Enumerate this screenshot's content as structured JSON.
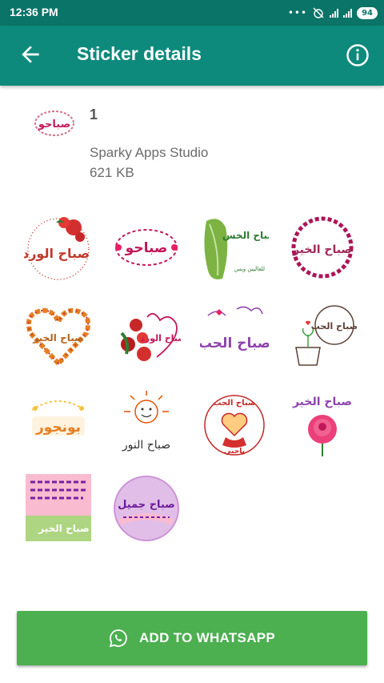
{
  "status_bar": {
    "time": "12:36 PM",
    "battery": "94"
  },
  "app_bar": {
    "title": "Sticker details",
    "back_icon": "arrow-left-icon",
    "info_icon": "info-icon"
  },
  "pack": {
    "name": "1",
    "publisher": "Sparky Apps Studio",
    "size": "621 KB",
    "icon_text": "صباحو"
  },
  "stickers": [
    {
      "text": "صباح الورد",
      "color": "#c0392b"
    },
    {
      "text": "صباحو",
      "color": "#c2185b"
    },
    {
      "text": "صباح الخس",
      "sub": "للغاليين وبس",
      "color": "#2e7d32"
    },
    {
      "text": "صباح الخير",
      "color": "#a0285a"
    },
    {
      "text": "صباح الخير",
      "color": "#b5651d"
    },
    {
      "text": "صباح الورد",
      "color": "#c2185b"
    },
    {
      "text": "صباح الحب",
      "color": "#8e44ad"
    },
    {
      "text": "صباح الحب",
      "color": "#5d4037"
    },
    {
      "text": "بونجور",
      "color": "#e67e22"
    },
    {
      "text": "صباح النور",
      "color": "#333333"
    },
    {
      "text": "صباح الحب",
      "sub": "ياحبي",
      "color": "#c62828"
    },
    {
      "text": "صباح الخير",
      "color": "#8e44ad"
    },
    {
      "text": "صباح الخير",
      "color": "#ec407a"
    },
    {
      "text": "صباح جميل",
      "color": "#6a1b9a"
    }
  ],
  "add_button": {
    "label": "ADD TO WHATSAPP",
    "icon": "whatsapp-icon",
    "color": "#4caf50"
  },
  "colors": {
    "status_bar": "#0b7468",
    "app_bar": "#0d8a7c"
  }
}
